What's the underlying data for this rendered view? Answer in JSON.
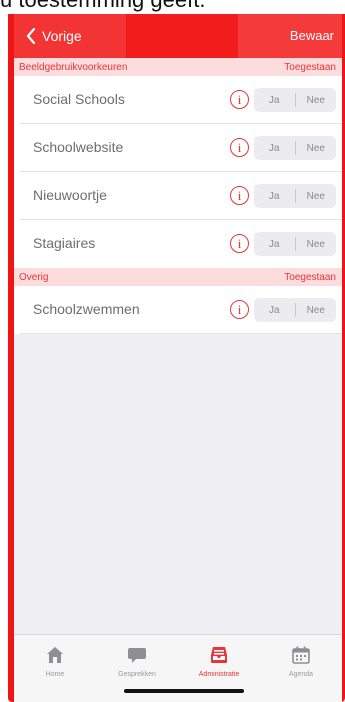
{
  "doc_text": "u toestemming geeft.",
  "nav": {
    "back_label": "Vorige",
    "save_label": "Bewaar"
  },
  "sections": [
    {
      "title": "Beeldgebruikvoorkeuren",
      "right": "Toegestaan",
      "rows": [
        {
          "label": "Social Schools",
          "yes": "Ja",
          "no": "Nee"
        },
        {
          "label": "Schoolwebsite",
          "yes": "Ja",
          "no": "Nee"
        },
        {
          "label": "Nieuwoortje",
          "yes": "Ja",
          "no": "Nee"
        },
        {
          "label": "Stagiaires",
          "yes": "Ja",
          "no": "Nee"
        }
      ]
    },
    {
      "title": "Overig",
      "right": "Toegestaan",
      "rows": [
        {
          "label": "Schoolzwemmen",
          "yes": "Ja",
          "no": "Nee"
        }
      ]
    }
  ],
  "tabs": [
    {
      "label": "Home",
      "icon": "home-icon",
      "active": false
    },
    {
      "label": "Gesprekken",
      "icon": "chat-bubble-icon",
      "active": false
    },
    {
      "label": "Administratie",
      "icon": "inbox-tray-icon",
      "active": true
    },
    {
      "label": "Agenda",
      "icon": "calendar-icon",
      "active": false
    }
  ],
  "colors": {
    "accent": "#e8353a",
    "frame": "#f01414",
    "section_bg": "#fcdcdc"
  }
}
